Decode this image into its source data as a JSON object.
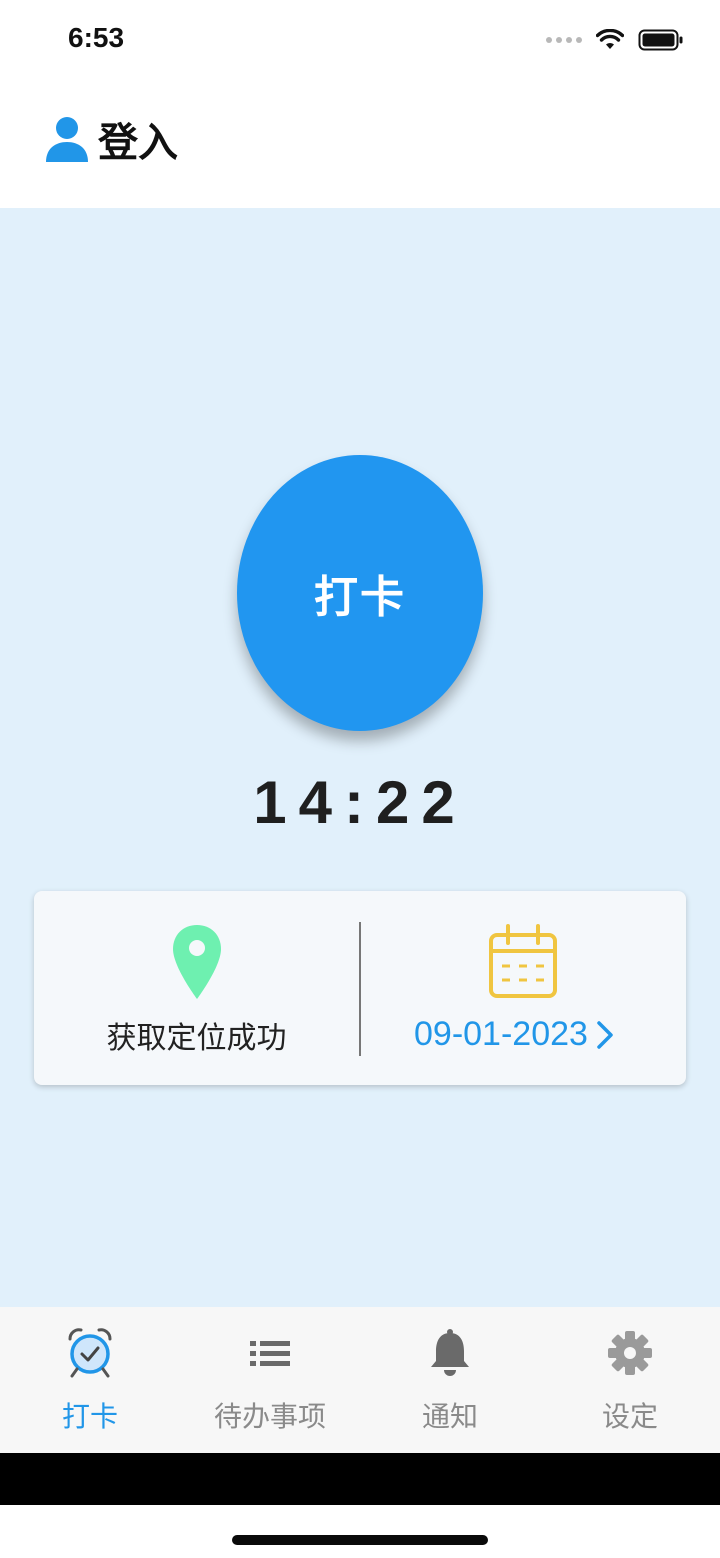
{
  "status_bar": {
    "time": "6:53"
  },
  "header": {
    "title": "登入",
    "icon": "user-icon"
  },
  "punch": {
    "button_label": "打卡",
    "current_time": "14:22"
  },
  "info_card": {
    "location_status": "获取定位成功",
    "location_icon": "map-pin-icon",
    "location_icon_color": "#6ef0b0",
    "date": "09-01-2023",
    "calendar_icon": "calendar-icon",
    "calendar_icon_color": "#f0c540"
  },
  "tabs": [
    {
      "label": "打卡",
      "icon": "alarm-clock-icon",
      "active": true
    },
    {
      "label": "待办事项",
      "icon": "list-icon",
      "active": false
    },
    {
      "label": "通知",
      "icon": "bell-icon",
      "active": false
    },
    {
      "label": "设定",
      "icon": "gear-icon",
      "active": false
    }
  ],
  "colors": {
    "accent": "#2196f0",
    "background": "#e1f0fb",
    "inactive_tab": "#8a8a8a"
  }
}
